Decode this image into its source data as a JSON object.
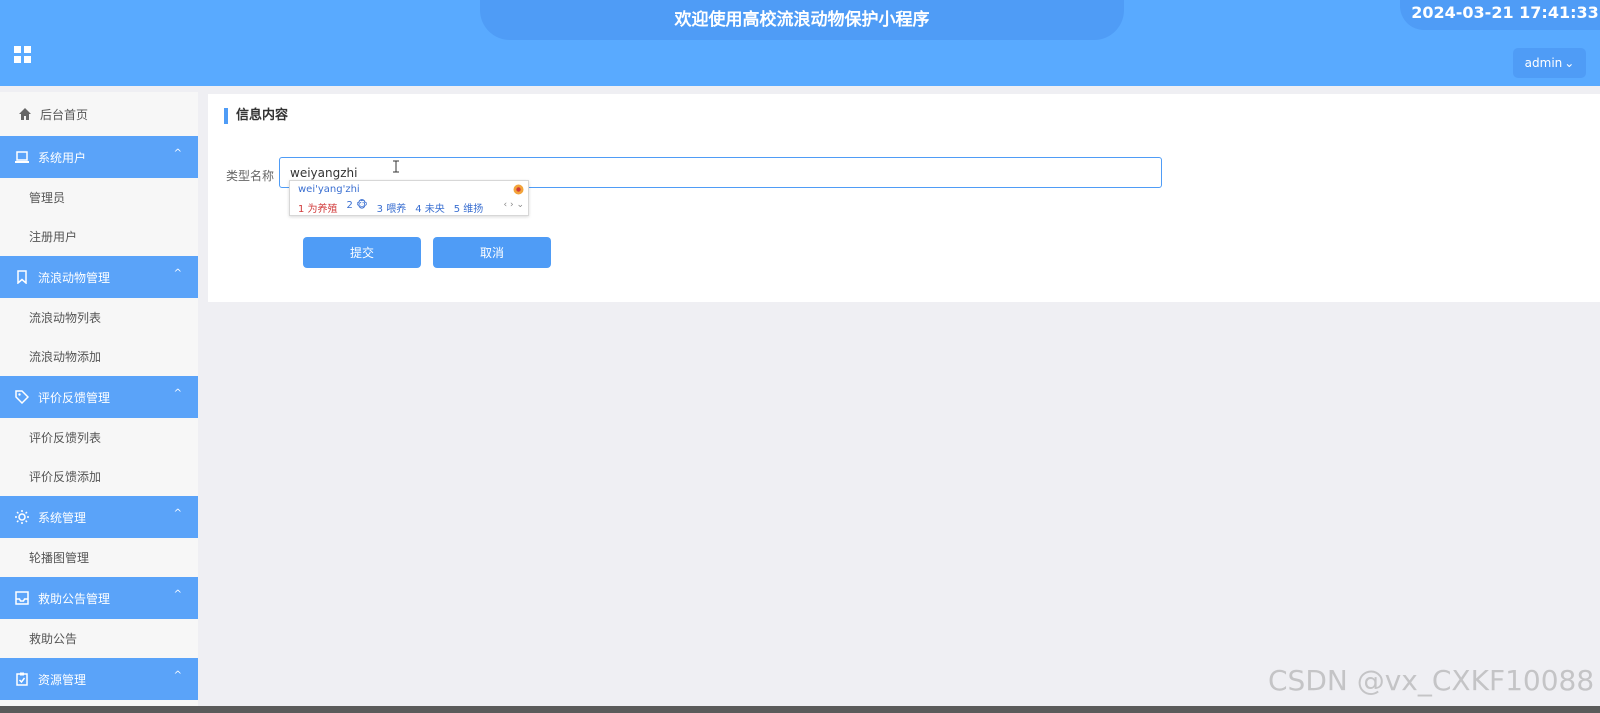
{
  "header": {
    "title": "欢迎使用高校流浪动物保护小程序",
    "datetime": "2024-03-21 17:41:33",
    "user_label": "admin",
    "user_caret": "⌄"
  },
  "sidebar": {
    "home": "后台首页",
    "groups": [
      {
        "label": "系统用户",
        "icon": "laptop-icon",
        "items": [
          "管理员",
          "注册用户"
        ]
      },
      {
        "label": "流浪动物管理",
        "icon": "bookmark-icon",
        "items": [
          "流浪动物列表",
          "流浪动物添加"
        ]
      },
      {
        "label": "评价反馈管理",
        "icon": "tag-icon",
        "items": [
          "评价反馈列表",
          "评价反馈添加"
        ]
      },
      {
        "label": "系统管理",
        "icon": "gear-icon",
        "items": [
          "轮播图管理"
        ]
      },
      {
        "label": "救助公告管理",
        "icon": "inbox-icon",
        "items": [
          "救助公告"
        ]
      },
      {
        "label": "资源管理",
        "icon": "clipboard-icon",
        "items": []
      }
    ],
    "chevron": "^"
  },
  "form": {
    "section_title": "信息内容",
    "field_label": "类型名称",
    "field_value": "weiyangzhi",
    "submit_label": "提交",
    "cancel_label": "取消"
  },
  "ime": {
    "pinyin": "wei'yang'zhi",
    "candidates": [
      "1 为养殖",
      "2 🐵",
      "3 喂养",
      "4 未央",
      "5 维扬"
    ],
    "nav": "‹ › ⌄"
  },
  "watermark": "CSDN @vx_CXKF10088",
  "colors": {
    "header": "#59aaff",
    "accent": "#4f9cf6",
    "menu_group": "#5aa3f9",
    "background": "#efeff3"
  }
}
